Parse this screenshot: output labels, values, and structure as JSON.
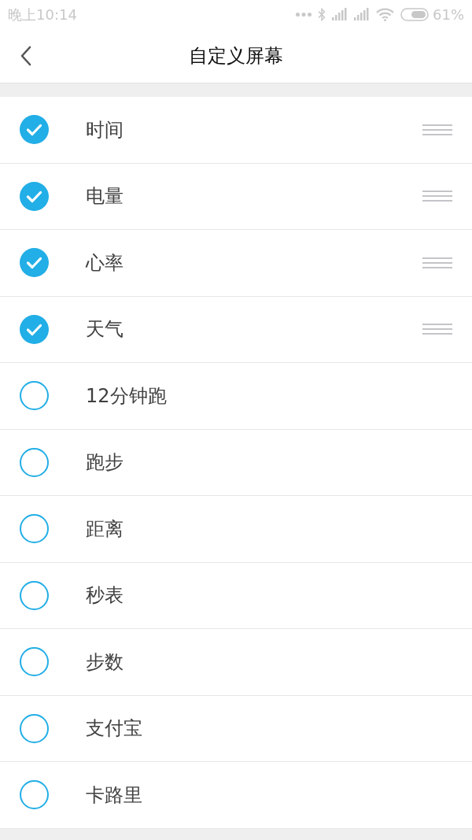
{
  "status_bar": {
    "time": "晚上10:14",
    "battery": "61%"
  },
  "header": {
    "title": "自定义屏幕"
  },
  "items": [
    {
      "label": "时间",
      "checked": true
    },
    {
      "label": "电量",
      "checked": true
    },
    {
      "label": "心率",
      "checked": true
    },
    {
      "label": "天气",
      "checked": true
    },
    {
      "label": "12分钟跑",
      "checked": false
    },
    {
      "label": "跑步",
      "checked": false
    },
    {
      "label": "距离",
      "checked": false
    },
    {
      "label": "秒表",
      "checked": false
    },
    {
      "label": "步数",
      "checked": false
    },
    {
      "label": "支付宝",
      "checked": false
    },
    {
      "label": "卡路里",
      "checked": false
    }
  ]
}
